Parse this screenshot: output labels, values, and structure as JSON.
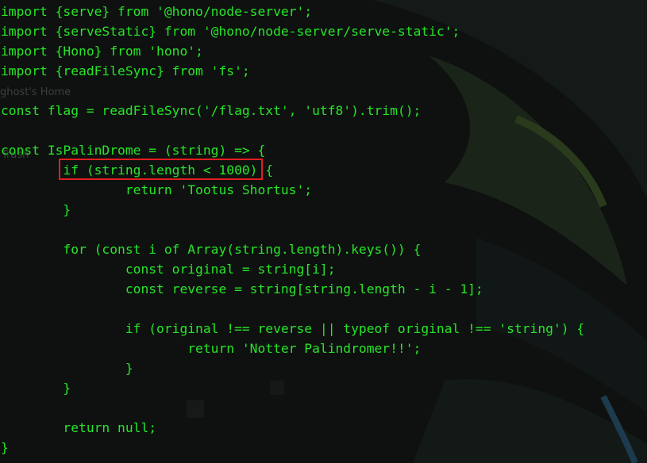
{
  "desktop": {
    "ghost_home_label": "ghost's Home",
    "trash_label": "Trash"
  },
  "editor": {
    "text_color": "#27e527",
    "highlight_color": "#e41e1e",
    "highlighted_text": "if (string.length < 1000)",
    "lines": [
      "import {serve} from '@hono/node-server';",
      "import {serveStatic} from '@hono/node-server/serve-static';",
      "import {Hono} from 'hono';",
      "import {readFileSync} from 'fs';",
      "",
      "const flag = readFileSync('/flag.txt', 'utf8').trim();",
      "",
      "const IsPalinDrome = (string) => {",
      "        if (string.length < 1000) {",
      "                return 'Tootus Shortus';",
      "        }",
      "",
      "        for (const i of Array(string.length).keys()) {",
      "                const original = string[i];",
      "                const reverse = string[string.length - i - 1];",
      "",
      "                if (original !== reverse || typeof original !== 'string') {",
      "                        return 'Notter Palindromer!!';",
      "                }",
      "        }",
      "",
      "        return null;",
      "}"
    ]
  }
}
